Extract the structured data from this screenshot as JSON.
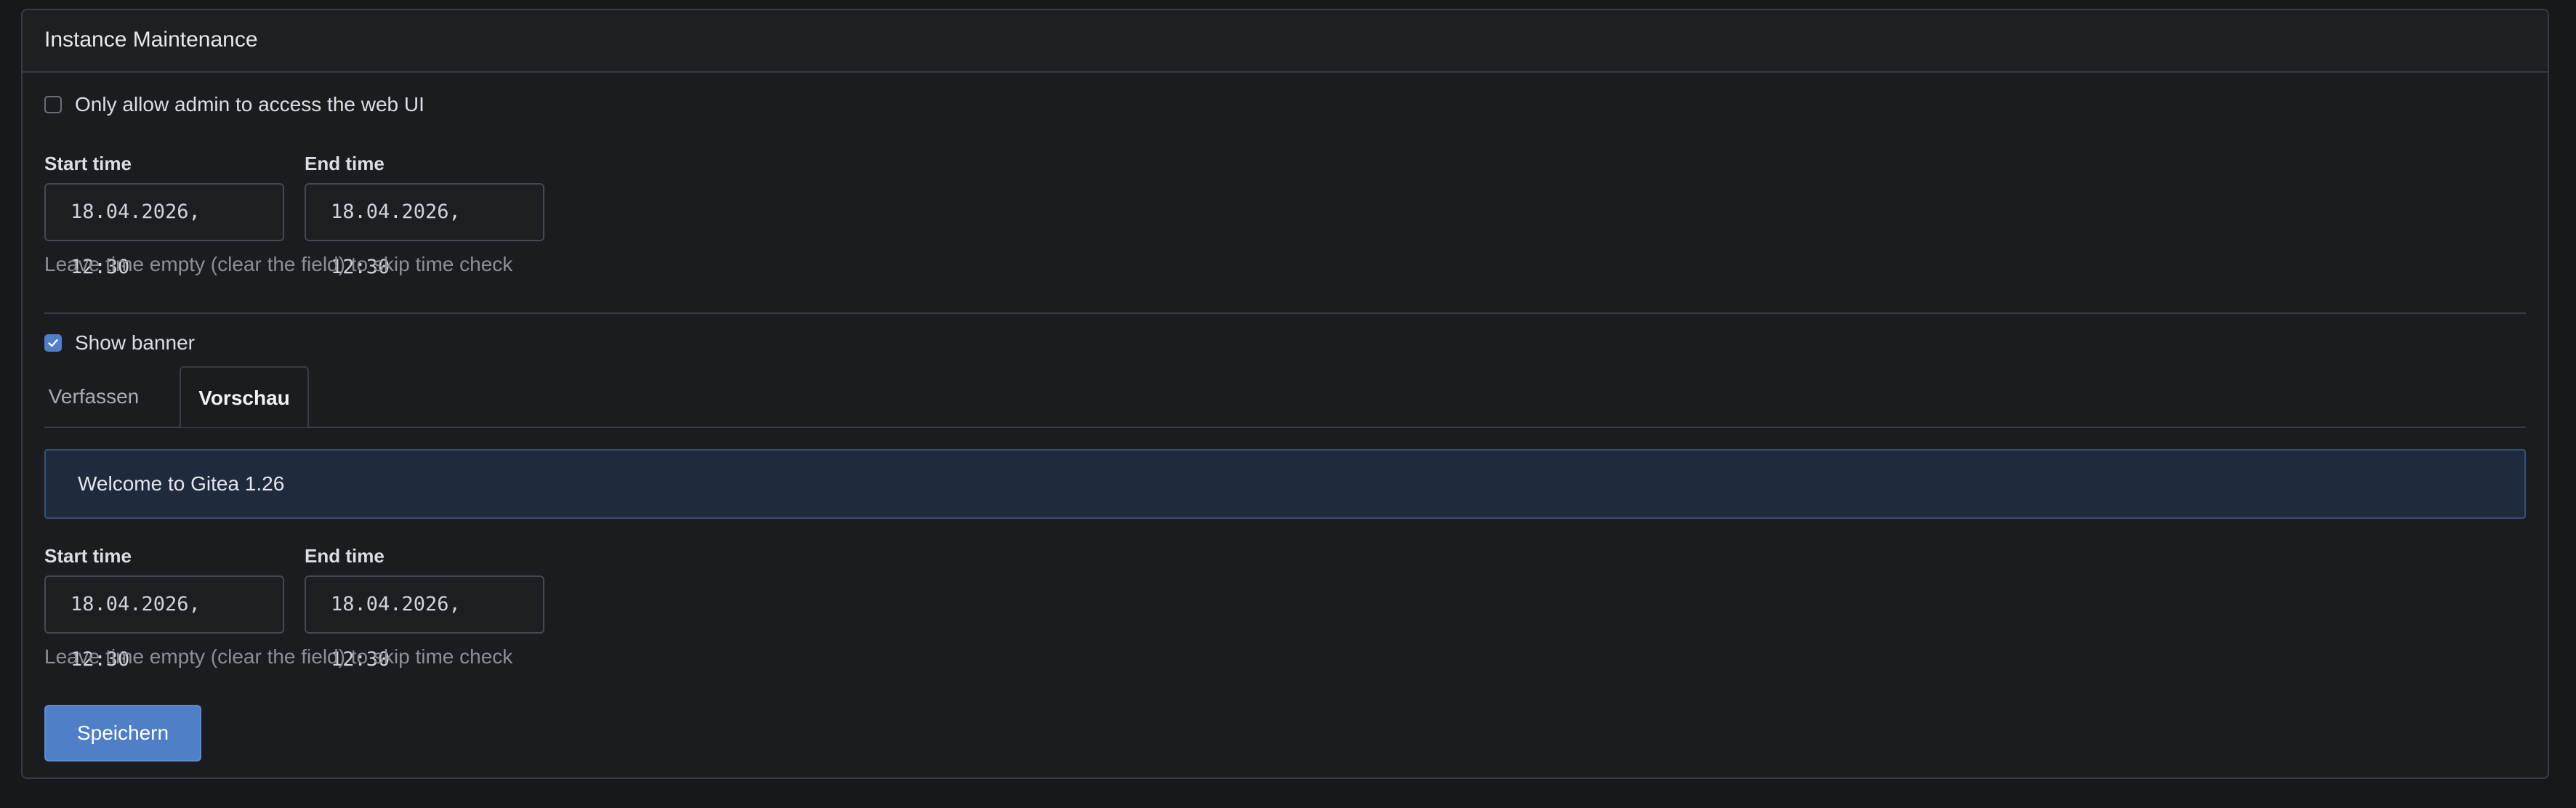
{
  "panel": {
    "title": "Instance Maintenance"
  },
  "admin_only": {
    "label": "Only allow admin to access the web UI",
    "checked": false
  },
  "admin_window": {
    "start_label": "Start time",
    "start_value": "18.04.2026, 12:30",
    "end_label": "End time",
    "end_value": "18.04.2026, 12:30",
    "help": "Leave time empty (clear the field) to skip time check"
  },
  "banner_toggle": {
    "label": "Show banner",
    "checked": true
  },
  "tabs": [
    {
      "label": "Verfassen",
      "active": false
    },
    {
      "label": "Vorschau",
      "active": true
    }
  ],
  "banner_preview": {
    "text": "Welcome to Gitea 1.26"
  },
  "banner_window": {
    "start_label": "Start time",
    "start_value": "18.04.2026, 12:30",
    "end_label": "End time",
    "end_value": "18.04.2026, 12:30",
    "help": "Leave time empty (clear the field) to skip time check"
  },
  "save_button": {
    "label": "Speichern"
  },
  "colors": {
    "accent": "#4f7fc6",
    "background": "#17181b",
    "banner_bg": "#1f2a3c"
  }
}
